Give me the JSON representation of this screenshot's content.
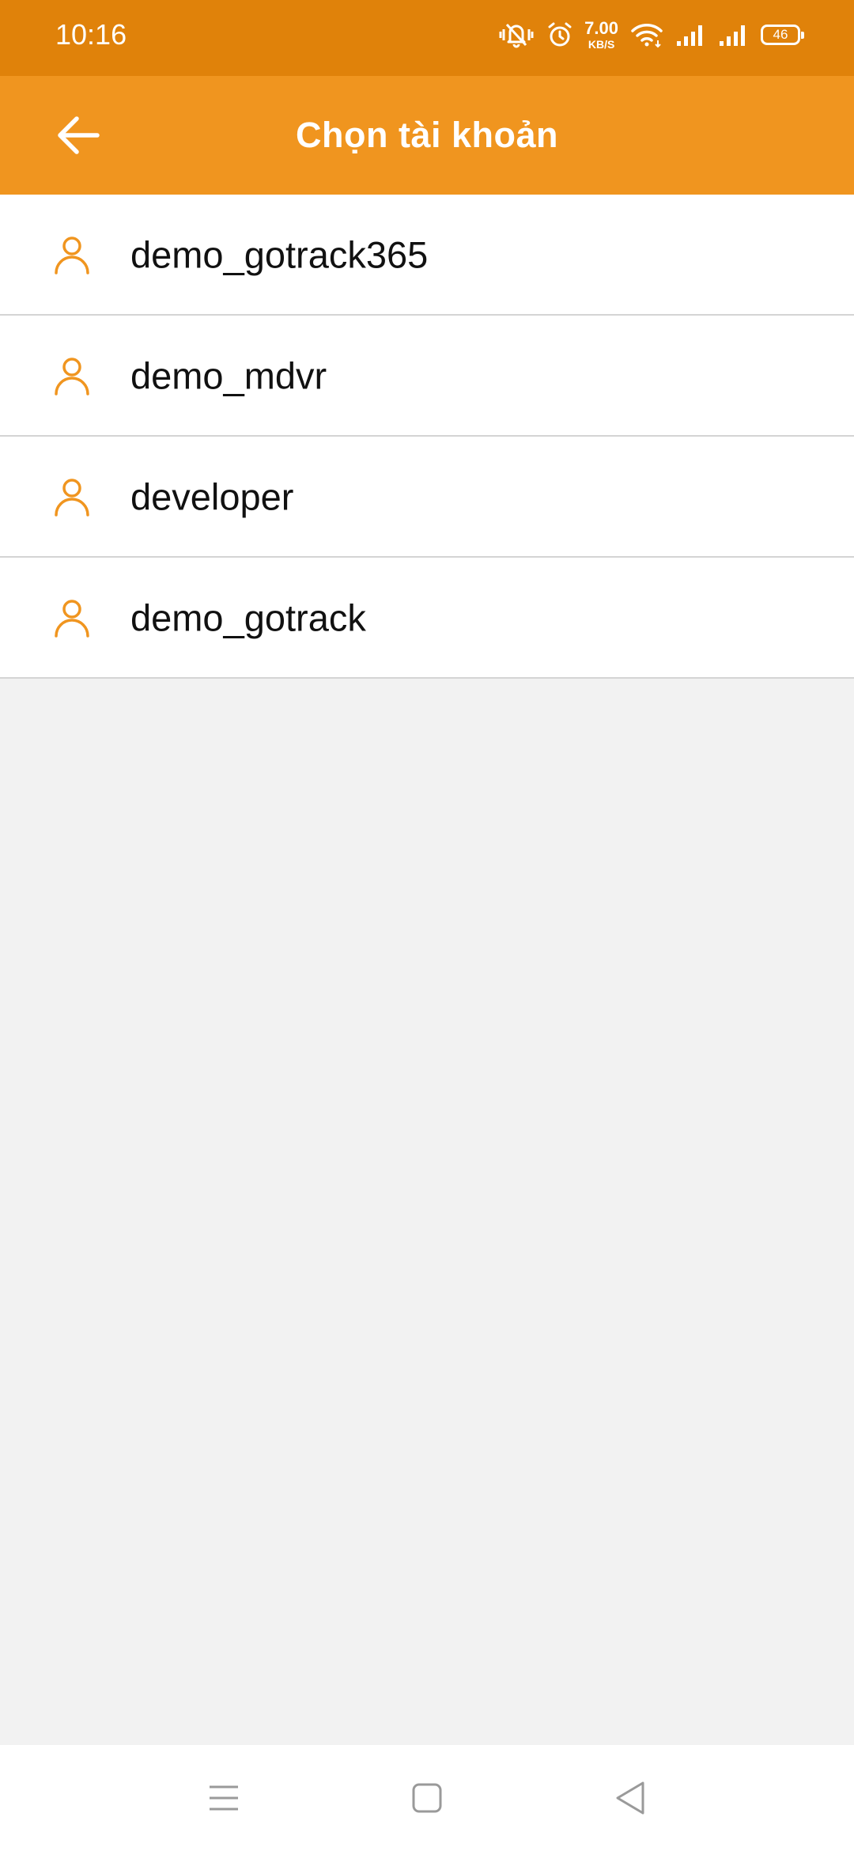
{
  "status_bar": {
    "time": "10:16",
    "net_speed_value": "7.00",
    "net_speed_unit": "KB/S",
    "battery": "46",
    "icons": [
      "vibrate-silent-icon",
      "alarm-icon",
      "wifi-icon",
      "signal-icon",
      "signal-icon",
      "battery-icon"
    ]
  },
  "app_bar": {
    "title": "Chọn tài khoản",
    "back_icon": "arrow-left-icon"
  },
  "accounts": [
    {
      "name": "demo_gotrack365",
      "icon": "user-icon"
    },
    {
      "name": "demo_mdvr",
      "icon": "user-icon"
    },
    {
      "name": "developer",
      "icon": "user-icon"
    },
    {
      "name": "demo_gotrack",
      "icon": "user-icon"
    }
  ],
  "nav_bar": {
    "icons": [
      "menu-icon",
      "home-icon",
      "back-triangle-icon"
    ]
  },
  "colors": {
    "status_bar": "#e0820a",
    "app_bar": "#f0951f",
    "accent": "#f0951f",
    "list_background": "#ffffff",
    "page_background": "#f2f2f2",
    "divider": "#d4d4d4"
  }
}
